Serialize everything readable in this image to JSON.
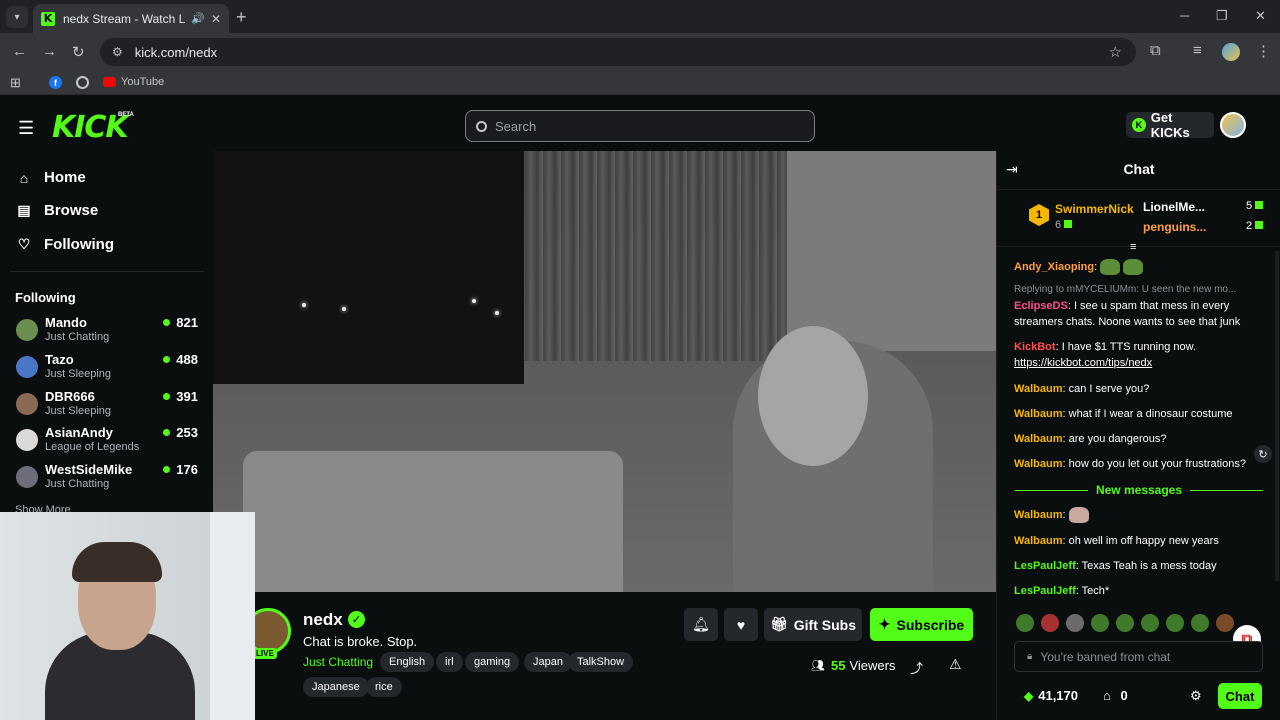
{
  "browser": {
    "tab_title": "nedx Stream - Watch Live on Kick",
    "url": "kick.com/nedx",
    "bookmarks": [
      "YouTube"
    ]
  },
  "header": {
    "logo": "KICK",
    "logo_badge": "BETA",
    "search_placeholder": "Search",
    "get_kicks_label": "Get KICKs"
  },
  "sidebar": {
    "nav": [
      {
        "label": "Home",
        "icon": "home-icon"
      },
      {
        "label": "Browse",
        "icon": "browse-icon"
      },
      {
        "label": "Following",
        "icon": "heart-icon"
      }
    ],
    "following_heading": "Following",
    "following": [
      {
        "name": "Mando",
        "category": "Just Chatting",
        "viewers": "821",
        "avatar_color": "#6a8f4f"
      },
      {
        "name": "Tazo",
        "category": "Just Sleeping",
        "viewers": "488",
        "avatar_color": "#4a76c8"
      },
      {
        "name": "DBR666",
        "category": "Just Sleeping",
        "viewers": "391",
        "avatar_color": "#8a6a55"
      },
      {
        "name": "AsianAndy",
        "category": "League of Legends",
        "viewers": "253",
        "avatar_color": "#d9d9d9"
      },
      {
        "name": "WestSideMike",
        "category": "Just Chatting",
        "viewers": "176",
        "avatar_color": "#6d6d7a"
      }
    ],
    "show_more": "Show More"
  },
  "channel": {
    "name": "nedx",
    "live_badge": "LIVE",
    "title": "Chat is broke. Stop.",
    "category": "Just Chatting",
    "tags": [
      "English",
      "irl",
      "gaming",
      "Japan",
      "TalkShow",
      "Japanese",
      "rice"
    ],
    "gift_subs_label": "Gift Subs",
    "subscribe_label": "Subscribe",
    "viewers_count": "55",
    "viewers_label": "Viewers"
  },
  "chat": {
    "title": "Chat",
    "leaderboard": {
      "first": {
        "rank": "1",
        "name": "SwimmerNick",
        "count": "6"
      },
      "second": {
        "name": "LionelMe...",
        "count": "5"
      },
      "third": {
        "name": "penguins...",
        "count": "2"
      }
    },
    "messages": [
      {
        "user": "Andy_Xiaoping",
        "color": "#ff9f43",
        "text": ""
      },
      {
        "reply": "Replying to mMYCELIUMm: U seen the new mo...",
        "user": "EclipseDS",
        "color": "#ff4f8b",
        "text": "I see u spam that mess in every streamers chats. Noone wants to see that junk"
      },
      {
        "user": "KickBot",
        "color": "#ff4f4f",
        "text": "I have $1 TTS running now.",
        "link": "https://kickbot.com/tips/nedx"
      },
      {
        "user": "Walbaum",
        "color": "#f5b800",
        "text": "can I serve you?"
      },
      {
        "user": "Walbaum",
        "color": "#f5b800",
        "text": "what if I wear a dinosaur costume"
      },
      {
        "user": "Walbaum",
        "color": "#f5b800",
        "text": "are you dangerous?"
      },
      {
        "user": "Walbaum",
        "color": "#f5b800",
        "text": "how do you let out your frustrations?"
      }
    ],
    "new_messages_label": "New messages",
    "new_messages": [
      {
        "user": "Walbaum",
        "color": "#f5b800",
        "text": ""
      },
      {
        "user": "Walbaum",
        "color": "#f5b800",
        "text": "oh well im off happy new years"
      },
      {
        "user": "LesPaulJeff",
        "color": "#53fc18",
        "text": "Texas Teah is a mess today"
      },
      {
        "user": "LesPaulJeff",
        "color": "#53fc18",
        "text": "Tech*"
      }
    ],
    "input_placeholder": "You're banned from chat",
    "points": "41,170",
    "store_count": "0",
    "send_label": "Chat"
  },
  "colors": {
    "accent": "#53fc18",
    "background": "#0b0e0f"
  }
}
